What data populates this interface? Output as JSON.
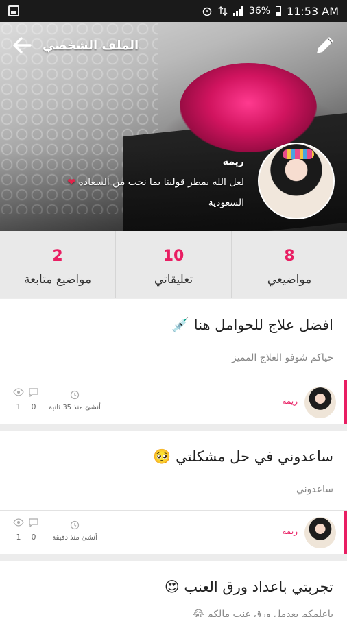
{
  "status_bar": {
    "battery": "36%",
    "time": "11:53 AM"
  },
  "header": {
    "title": "الملف الشخصي"
  },
  "profile": {
    "name": "ريمه",
    "bio": "لعل الله يمطر قولبنا بما نحب من السعاده",
    "country": "السعودية"
  },
  "stats": [
    {
      "value": "8",
      "label": "مواضيعي"
    },
    {
      "value": "10",
      "label": "تعليقاتي"
    },
    {
      "value": "2",
      "label": "مواضيع متابعة"
    }
  ],
  "posts": [
    {
      "title": "افضل علاج للحوامل هنا 💉",
      "excerpt": "حياكم شوفو العلاج المميز",
      "author": "ريمه",
      "time": "أنشئ منذ 35 ثانية",
      "comments": "0",
      "views": "1"
    },
    {
      "title": "ساعدوني في حل مشكلتي 🥺",
      "excerpt": "ساعدوني",
      "author": "ريمه",
      "time": "أنشئ منذ دقيقة",
      "comments": "0",
      "views": "1"
    },
    {
      "title": "تجربتي باعداد ورق العنب 😍",
      "excerpt": "باعلمكم بعدمل ورق عنب مالكم 😂"
    }
  ],
  "colors": {
    "accent": "#e91e63",
    "statusbar": "#1a1a1a"
  }
}
